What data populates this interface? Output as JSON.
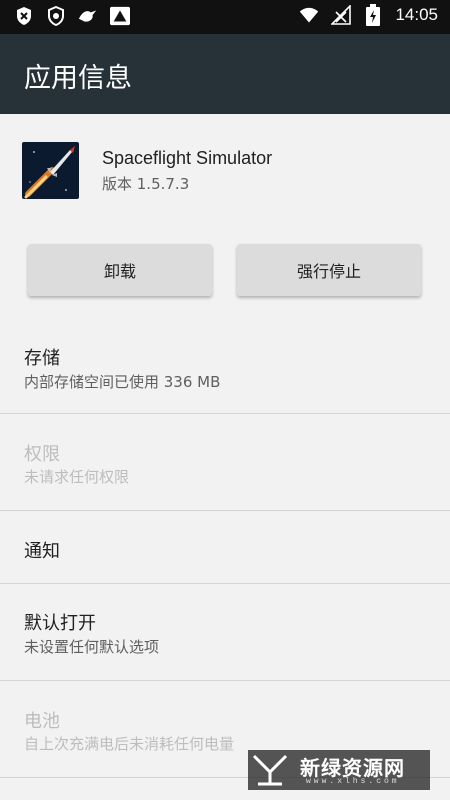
{
  "status_bar": {
    "time": "14:05",
    "left_icons": [
      "shield-x-icon",
      "shield-icon",
      "bird-icon",
      "warning-image-icon"
    ],
    "right_icons": [
      "wifi-icon",
      "no-signal-icon",
      "battery-charging-icon"
    ]
  },
  "app_bar": {
    "title": "应用信息"
  },
  "app": {
    "name": "Spaceflight Simulator",
    "version": "版本 1.5.7.3"
  },
  "buttons": {
    "uninstall": "卸载",
    "force_stop": "强行停止"
  },
  "settings": [
    {
      "title": "存储",
      "subtitle": "内部存储空间已使用 336 MB",
      "enabled": true
    },
    {
      "title": "权限",
      "subtitle": "未请求任何权限",
      "enabled": false
    },
    {
      "title": "通知",
      "subtitle": "",
      "enabled": true
    },
    {
      "title": "默认打开",
      "subtitle": "未设置任何默认选项",
      "enabled": true
    },
    {
      "title": "电池",
      "subtitle": "自上次充满电后未消耗任何电量",
      "enabled": false
    }
  ],
  "watermark": {
    "text": "新绿资源网",
    "url": "www.xlhs.com"
  },
  "colors": {
    "app_bar": "#263238",
    "status_bar": "#111111",
    "background": "#f2f2f2",
    "button": "#dcdcdc"
  }
}
